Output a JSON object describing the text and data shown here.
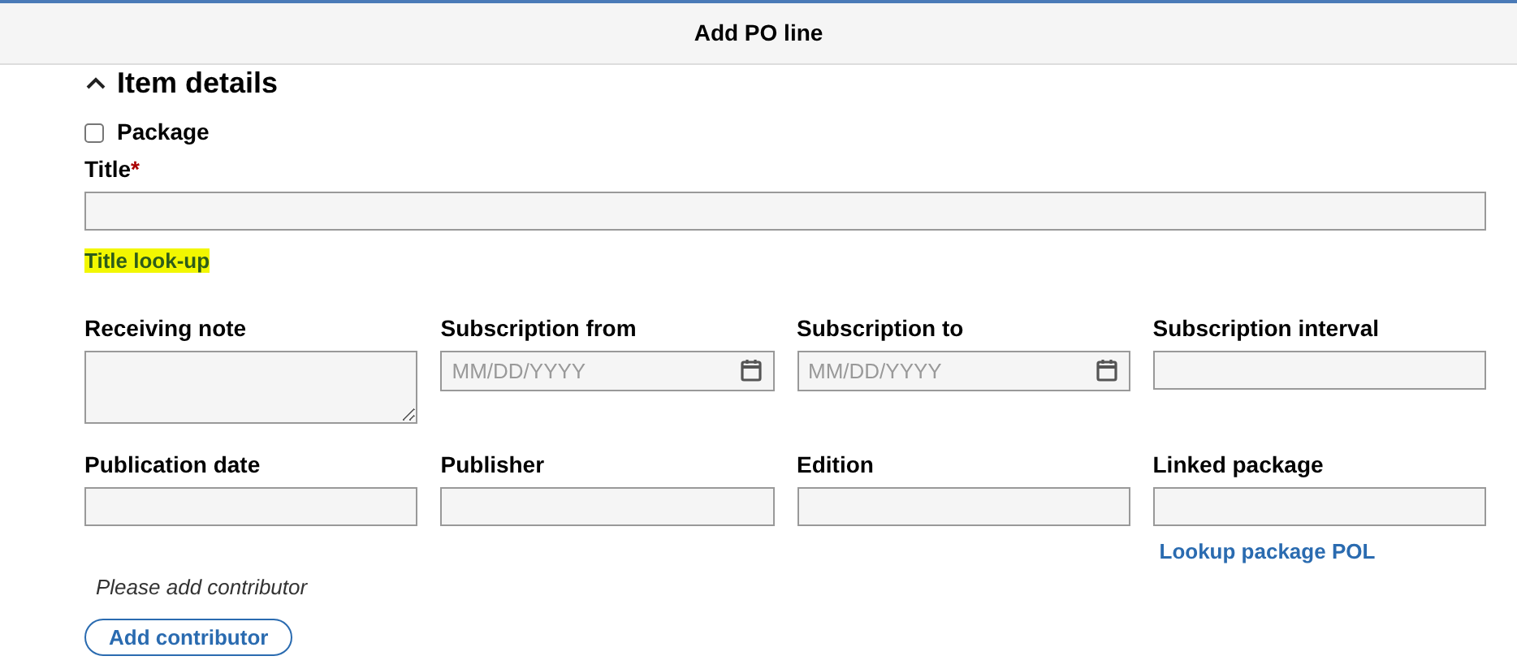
{
  "window": {
    "title": "Add PO line"
  },
  "section": {
    "title": "Item details",
    "expanded": true
  },
  "package": {
    "label": "Package",
    "checked": false
  },
  "title_field": {
    "label": "Title",
    "required": true,
    "required_mark": "*"
  },
  "title_lookup": {
    "label": "Title look-up",
    "highlighted": true
  },
  "fields": [
    {
      "label": "Receiving note",
      "kind": "textarea"
    },
    {
      "label": "Subscription from",
      "kind": "date",
      "placeholder": "MM/DD/YYYY"
    },
    {
      "label": "Subscription to",
      "kind": "date",
      "placeholder": "MM/DD/YYYY"
    },
    {
      "label": "Subscription interval",
      "kind": "text"
    },
    {
      "label": "Publication date",
      "kind": "text"
    },
    {
      "label": "Publisher",
      "kind": "text"
    },
    {
      "label": "Edition",
      "kind": "text"
    },
    {
      "label": "Linked package",
      "kind": "text",
      "link": "Lookup package POL"
    }
  ],
  "contributors": {
    "empty_message": "Please add contributor",
    "button": "Add contributor"
  }
}
